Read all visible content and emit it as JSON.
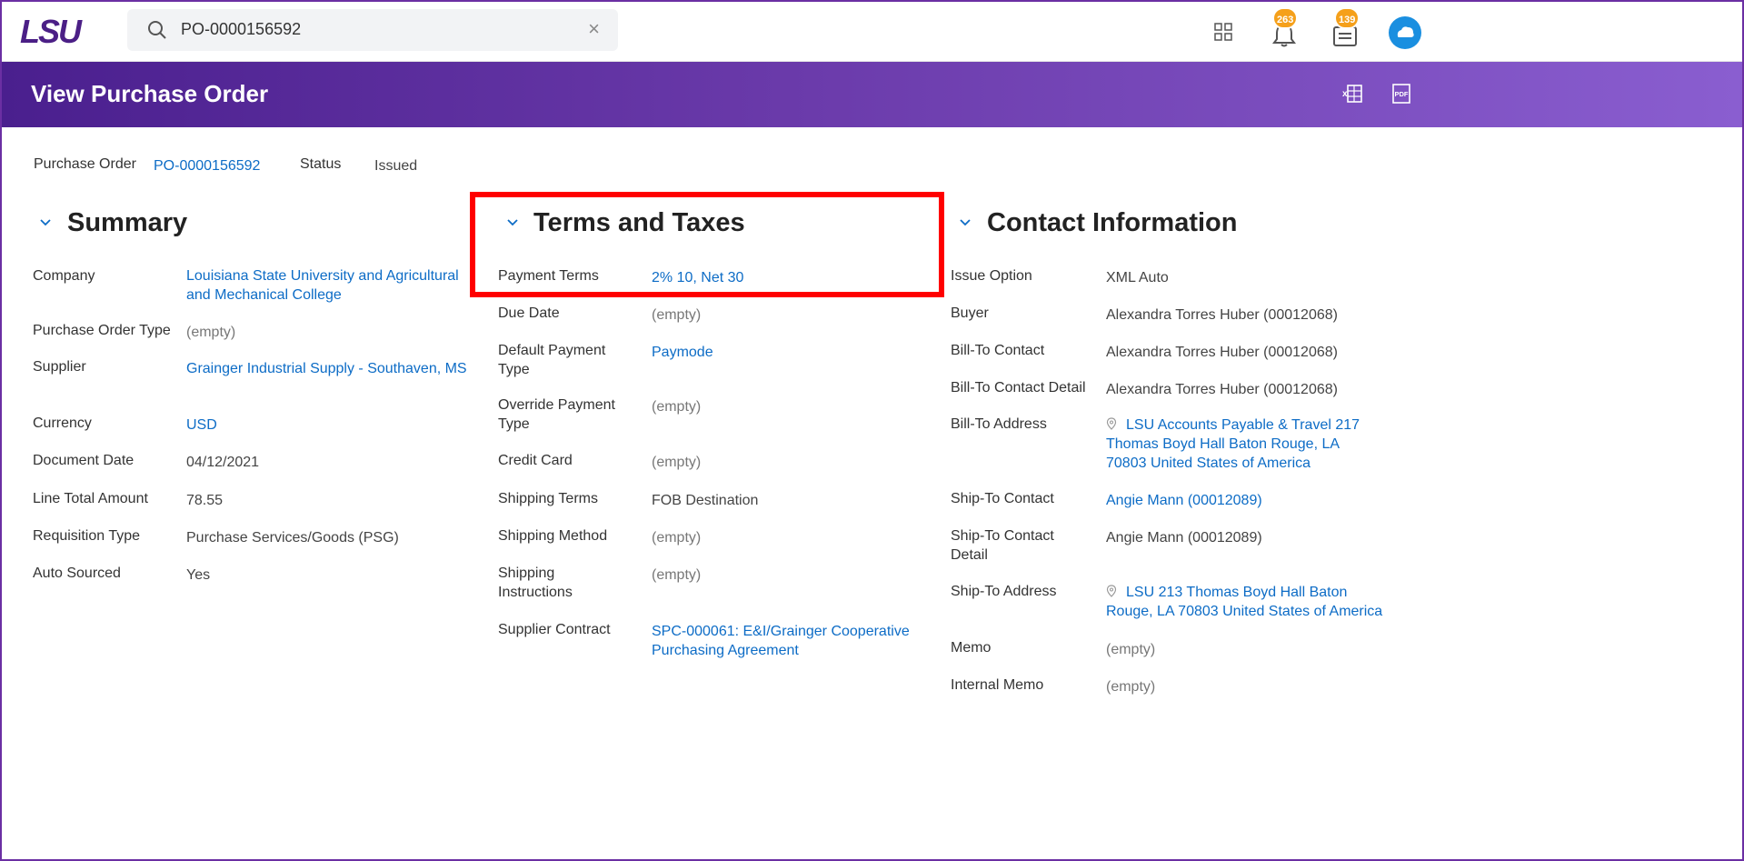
{
  "topbar": {
    "logo_alt": "LSU",
    "search_value": "PO-0000156592",
    "notifications_count": "263",
    "inbox_count": "139"
  },
  "header": {
    "title": "View Purchase Order"
  },
  "po": {
    "label": "Purchase Order",
    "number": "PO-0000156592",
    "status_label": "Status",
    "status_value": "Issued"
  },
  "summary": {
    "title": "Summary",
    "rows": [
      {
        "label": "Company",
        "value": "Louisiana State University and Agricultural and Mechanical College"
      },
      {
        "label": "Purchase Order Type",
        "value": "(empty)"
      },
      {
        "label": "Supplier",
        "value": "Grainger Industrial Supply - Southaven, MS"
      },
      {
        "label": "Currency",
        "value": "USD"
      },
      {
        "label": "Document Date",
        "value": "04/12/2021"
      },
      {
        "label": "Line Total Amount",
        "value": "78.55"
      },
      {
        "label": "Requisition Type",
        "value": "Purchase Services/Goods (PSG)"
      },
      {
        "label": "Auto Sourced",
        "value": "Yes"
      }
    ]
  },
  "terms": {
    "title": "Terms and Taxes",
    "rows": [
      {
        "label": "Payment Terms",
        "value": "2% 10, Net 30"
      },
      {
        "label": "Due Date",
        "value": "(empty)"
      },
      {
        "label": "Default Payment Type",
        "value": "Paymode"
      },
      {
        "label": "Override Payment Type",
        "value": "(empty)"
      },
      {
        "label": "Credit Card",
        "value": "(empty)"
      },
      {
        "label": "Shipping Terms",
        "value": "FOB Destination"
      },
      {
        "label": "Shipping Method",
        "value": "(empty)"
      },
      {
        "label": "Shipping Instructions",
        "value": "(empty)"
      },
      {
        "label": "Supplier Contract",
        "value": "SPC-000061: E&I/Grainger Cooperative Purchasing Agreement"
      }
    ]
  },
  "contact": {
    "title": "Contact Information",
    "rows": [
      {
        "label": "Issue Option",
        "value": "XML Auto"
      },
      {
        "label": "Buyer",
        "value": "Alexandra Torres Huber (00012068)"
      },
      {
        "label": "Bill-To Contact",
        "value": "Alexandra Torres Huber (00012068)"
      },
      {
        "label": "Bill-To Contact Detail",
        "value": "Alexandra Torres Huber (00012068)"
      },
      {
        "label": "Bill-To Address",
        "value": "LSU Accounts Payable & Travel 217 Thomas Boyd Hall Baton Rouge, LA 70803 United States of America"
      },
      {
        "label": "Ship-To Contact",
        "value": "Angie Mann (00012089)"
      },
      {
        "label": "Ship-To Contact Detail",
        "value": "Angie Mann (00012089)"
      },
      {
        "label": "Ship-To Address",
        "value": "LSU 213 Thomas Boyd Hall Baton Rouge, LA 70803 United States of America"
      },
      {
        "label": "Memo",
        "value": "(empty)"
      },
      {
        "label": "Internal Memo",
        "value": "(empty)"
      }
    ]
  },
  "colors": {
    "brand_purple": "#5b2a9a",
    "link_blue": "#0d6cc6",
    "highlight_red": "#ff0000",
    "badge_orange": "#f5a01a"
  }
}
